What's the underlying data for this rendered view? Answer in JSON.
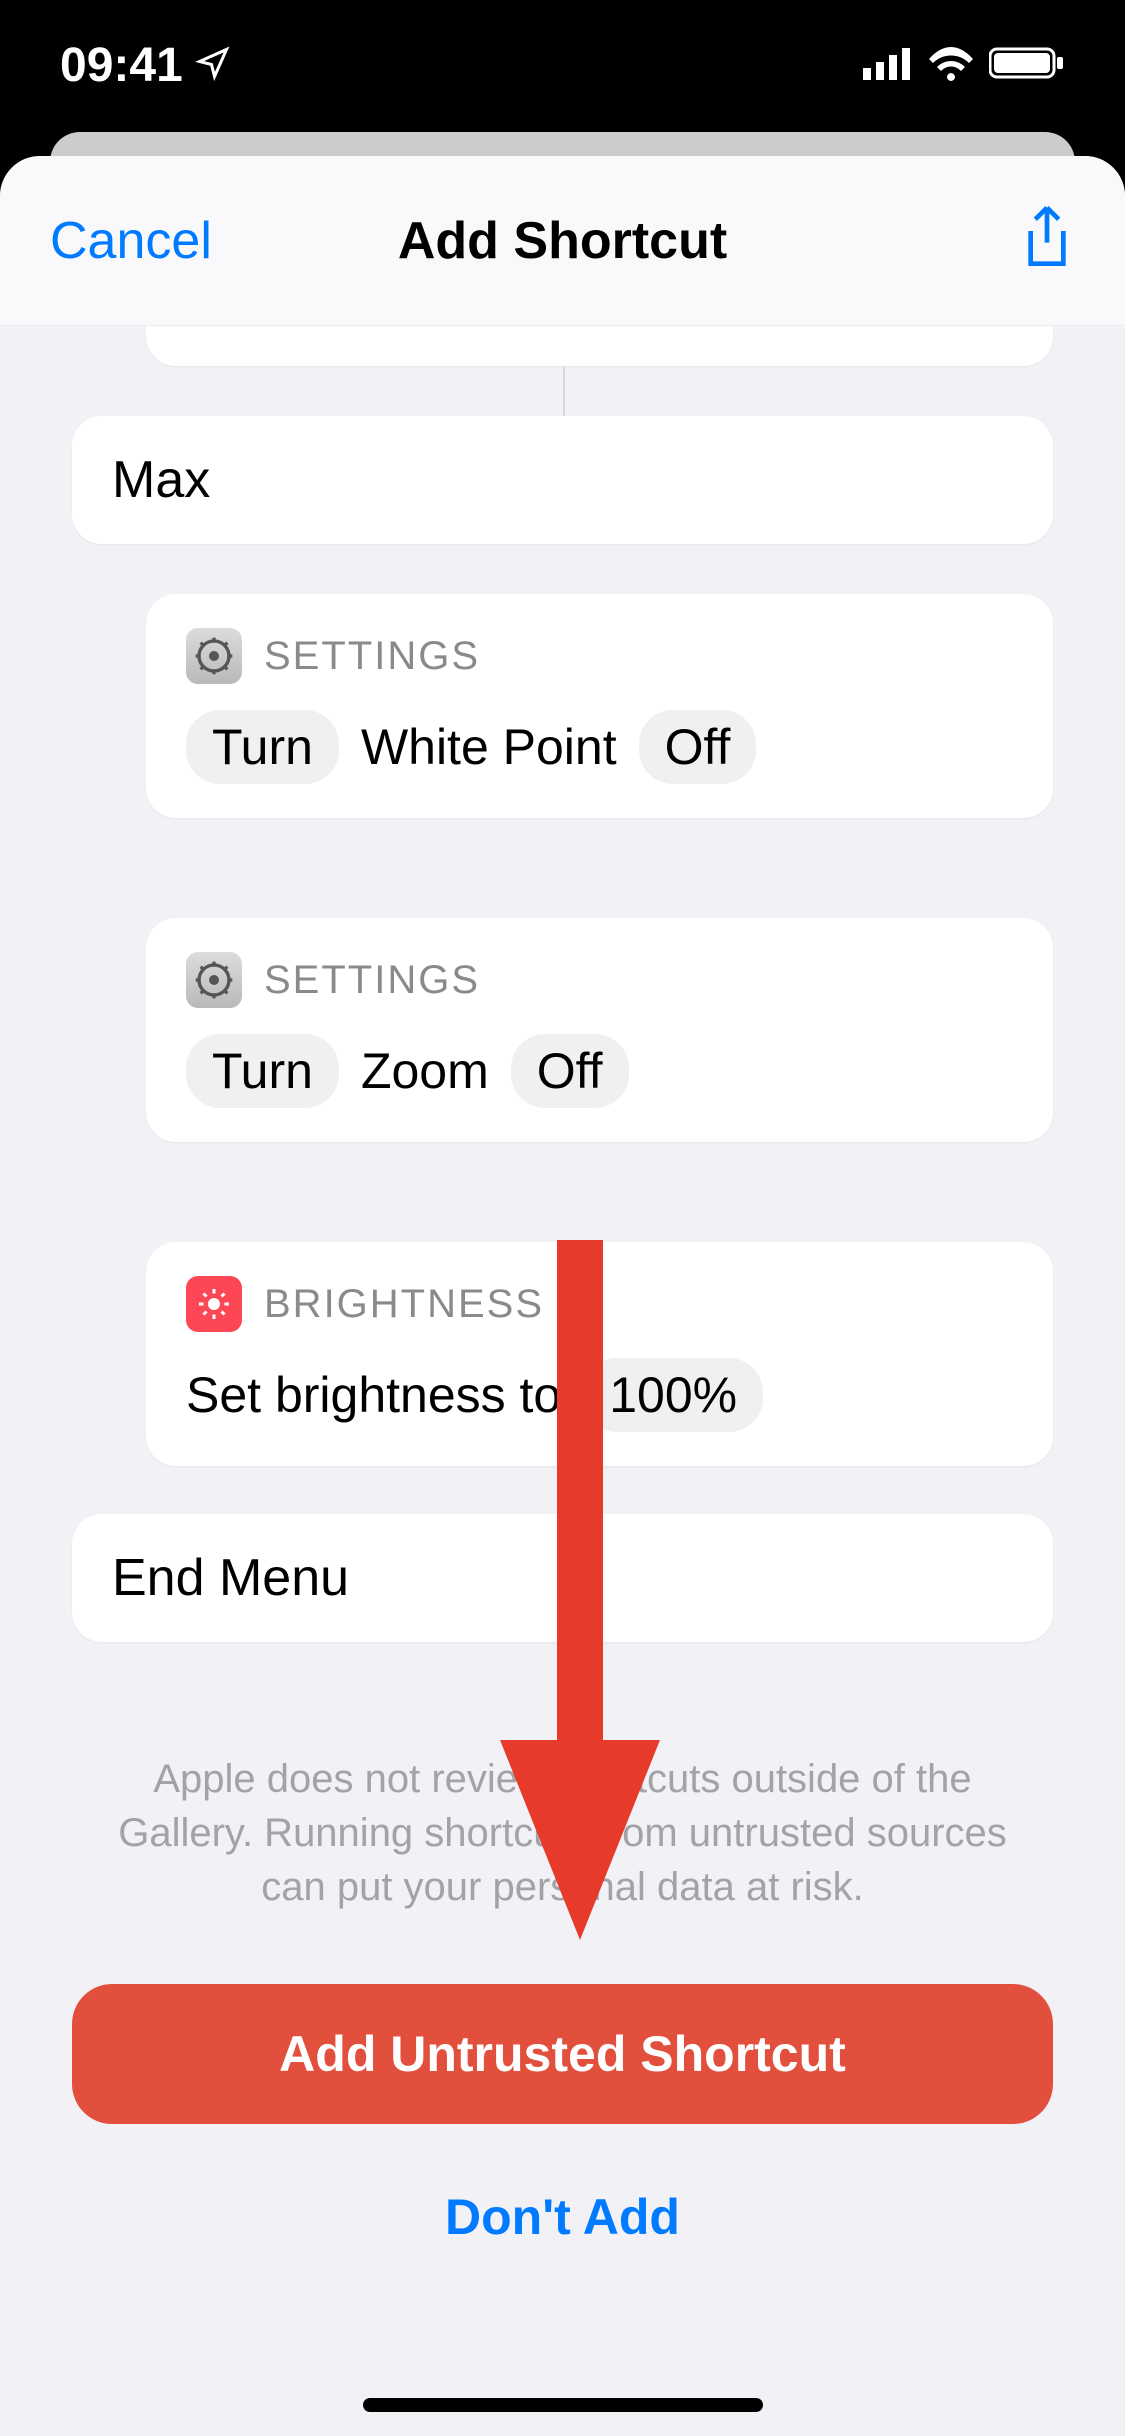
{
  "status": {
    "time": "09:41"
  },
  "header": {
    "cancel": "Cancel",
    "title": "Add Shortcut"
  },
  "cards": {
    "max_label": "Max",
    "settingsApp": "SETTINGS",
    "brightnessApp": "BRIGHTNESS",
    "action1": {
      "turn": "Turn",
      "feature": "White Point",
      "state": "Off"
    },
    "action2": {
      "turn": "Turn",
      "feature": "Zoom",
      "state": "Off"
    },
    "action3": {
      "prefix": "Set brightness to",
      "value": "100%"
    },
    "end_menu": "End Menu"
  },
  "disclaimer": "Apple does not review shortcuts outside of the Gallery. Running shortcuts from untrusted sources can put your personal data at risk.",
  "buttons": {
    "add": "Add Untrusted Shortcut",
    "dont": "Don't Add"
  }
}
